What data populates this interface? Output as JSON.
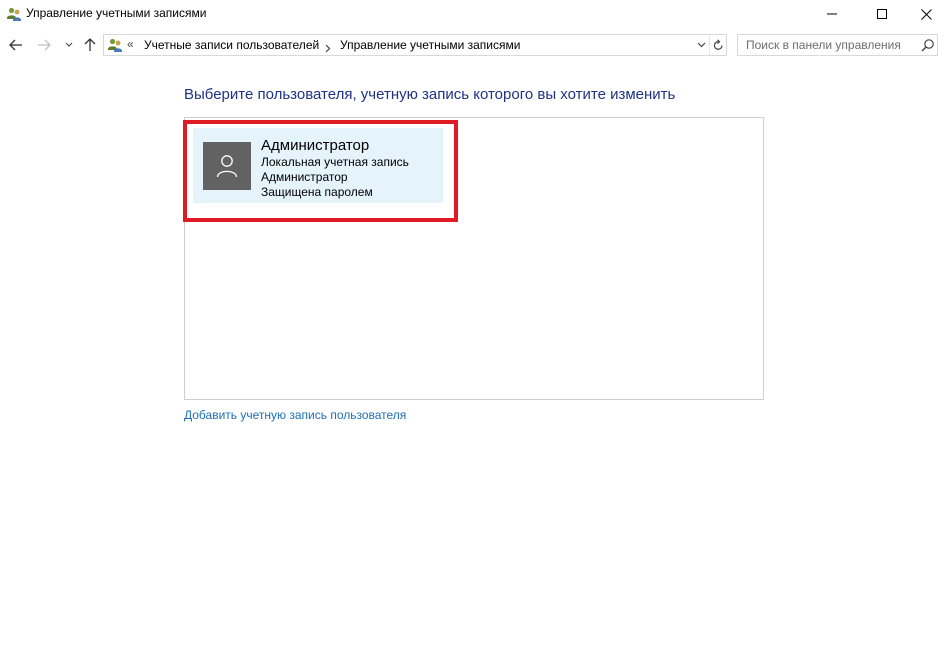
{
  "window": {
    "title": "Управление учетными записями",
    "icon": "user-accounts-icon"
  },
  "navigation": {
    "back_icon": "arrow-left-icon",
    "forward_icon": "arrow-right-icon",
    "recent_icon": "chevron-down-icon",
    "up_icon": "arrow-up-icon"
  },
  "address_bar": {
    "overflow": "«",
    "breadcrumbs": [
      {
        "label": "Учетные записи пользователей"
      },
      {
        "label": "Управление учетными записями"
      }
    ]
  },
  "search": {
    "placeholder": "Поиск в панели управления",
    "value": ""
  },
  "main": {
    "heading": "Выберите пользователя, учетную запись которого вы хотите изменить",
    "accounts": [
      {
        "name": "Администратор",
        "type": "Локальная учетная запись",
        "role": "Администратор",
        "status": "Защищена паролем"
      }
    ],
    "add_account_link": "Добавить учетную запись пользователя"
  },
  "colors": {
    "heading": "#1e3287",
    "link": "#1e6fb8",
    "tile_bg": "#e5f3fb",
    "avatar_bg": "#626262",
    "highlight": "#e01b24"
  }
}
